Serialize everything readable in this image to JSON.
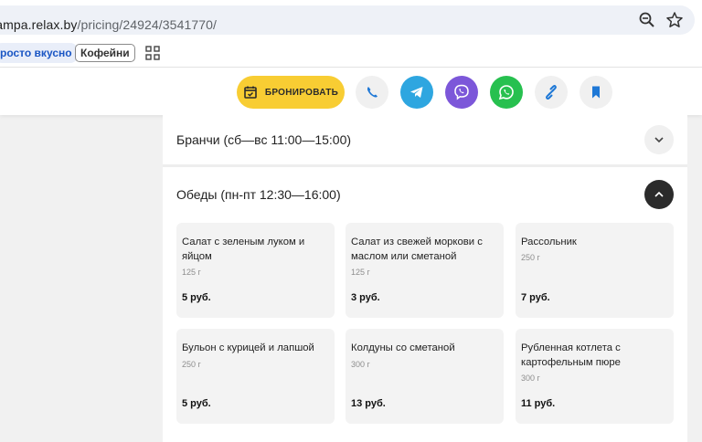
{
  "browser": {
    "url_domain": "lampa.relax.by",
    "url_path": "/pricing/24924/3541770/",
    "bookmarks": [
      "росто вкусно",
      "Кофейни"
    ]
  },
  "actions": {
    "book_label": "БРОНИРОВАТЬ",
    "colors": {
      "book": "#f8cd33",
      "telegram": "#2ea6e0",
      "viber": "#7c57d9",
      "whatsapp": "#27c04f"
    },
    "icons": [
      "calendar-check-icon",
      "phone-icon",
      "telegram-icon",
      "viber-icon",
      "whatsapp-icon",
      "link-icon",
      "bookmark-icon"
    ]
  },
  "menu": {
    "sections": [
      {
        "title": "Бранчи (сб—вс 11:00—15:00)",
        "state": "collapsed"
      },
      {
        "title": "Обеды (пн-пт 12:30—16:00)",
        "state": "expanded"
      }
    ],
    "items": [
      {
        "name": "Салат с зеленым луком и яйцом",
        "weight": "125 г",
        "price": "5 руб."
      },
      {
        "name": "Салат из свежей моркови с маслом или сметаной",
        "weight": "125 г",
        "price": "3 руб."
      },
      {
        "name": "Рассольник",
        "weight": "250 г",
        "price": "7 руб."
      },
      {
        "name": "Бульон с курицей и лапшой",
        "weight": "250 г",
        "price": "5 руб."
      },
      {
        "name": "Колдуны со сметаной",
        "weight": "300 г",
        "price": "13 руб."
      },
      {
        "name": "Рубленная котлета с картофельным пюре",
        "weight": "300 г",
        "price": "11 руб."
      }
    ]
  }
}
